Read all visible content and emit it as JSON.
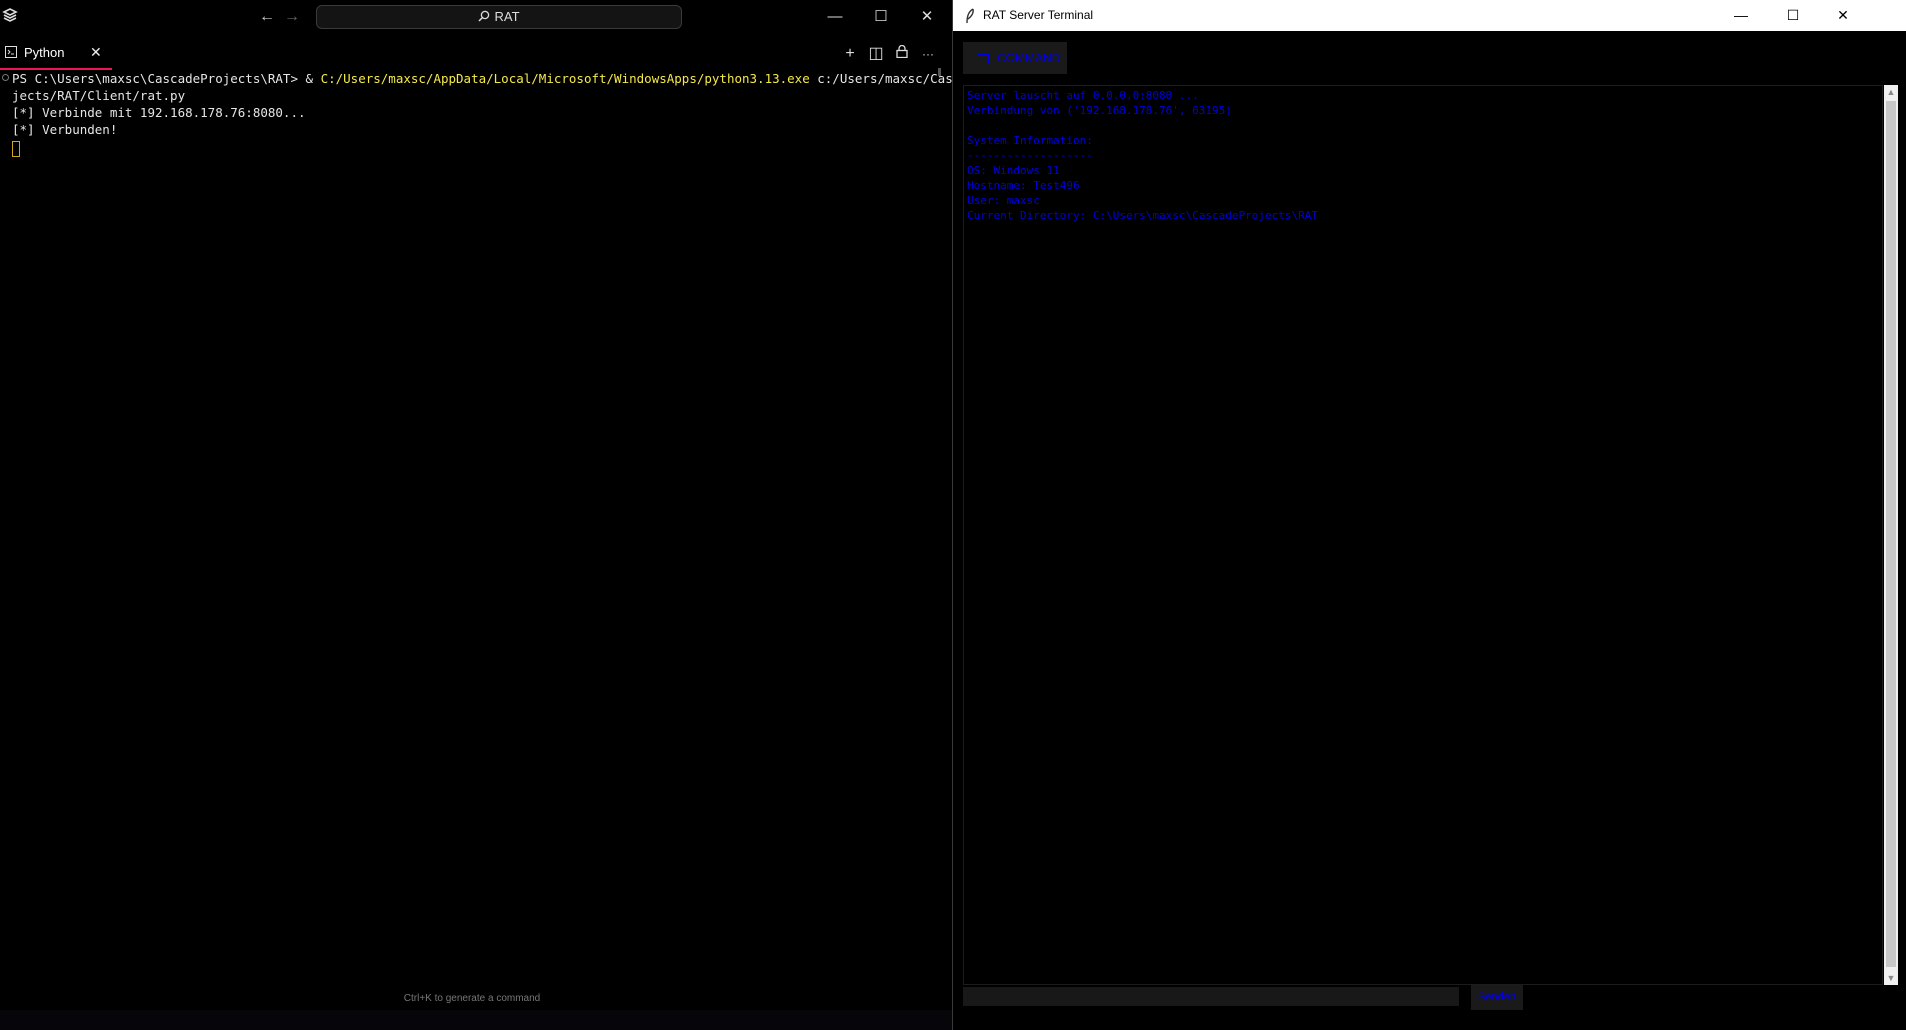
{
  "left_window": {
    "search_label": "RAT",
    "controls": {
      "minimize": "—",
      "maximize": "☐",
      "close": "✕"
    },
    "tab": {
      "label": "Python",
      "close": "✕"
    },
    "toolbar": {
      "new_terminal": "+",
      "split": "◫",
      "lock": "🔒",
      "more": "···"
    },
    "terminal": {
      "prompt": "PS C:\\Users\\maxsc\\CascadeProjects\\RAT> & ",
      "python_path": "C:/Users/maxsc/AppData/Local/Microsoft/WindowsApps/python3.13.exe",
      "script_path_1": " c:/Users/maxsc/CascadePro",
      "script_path_2": "jects/RAT/Client/rat.py",
      "line_connecting": "[*] Verbinde mit 192.168.178.76:8080...",
      "line_connected": "[*] Verbunden!"
    },
    "hint": "Ctrl+K to generate a command"
  },
  "right_window": {
    "title": "RAT Server Terminal",
    "controls": {
      "minimize": "—",
      "maximize": "☐",
      "close": "✕"
    },
    "command_button": "COMMAND",
    "output_lines": [
      "Server lauscht auf 0.0.0.0:8080 ...",
      "Verbindung von ('192.168.178.76', 63195)",
      "",
      "System Information:",
      "-------------------",
      "OS: Windows 11",
      "Hostname: Test496",
      "User: maxsc",
      "Current Directory: C:\\Users\\maxsc\\CascadeProjects\\RAT"
    ],
    "send_button": "Senden",
    "text_color": "#0000e0"
  }
}
